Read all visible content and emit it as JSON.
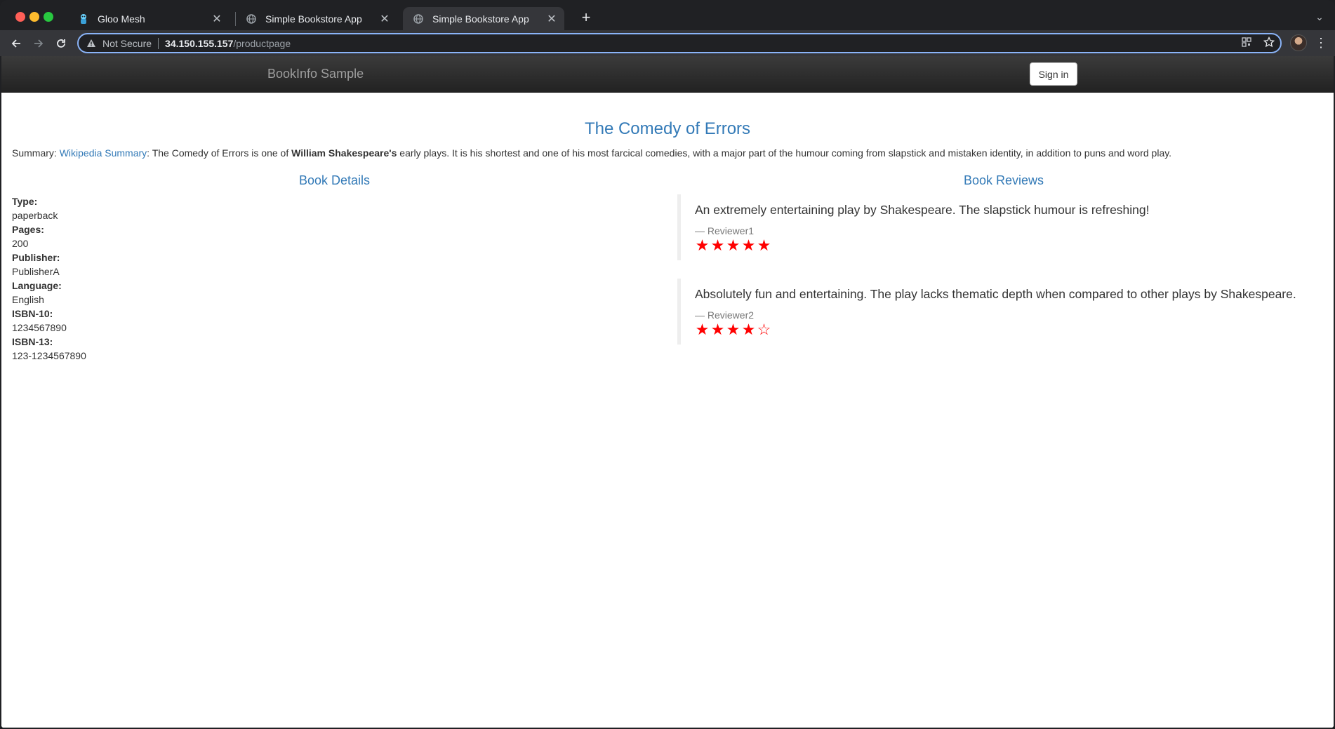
{
  "browser": {
    "tabs": [
      {
        "title": "Gloo Mesh",
        "icon": "gloo-mesh-icon",
        "active": false
      },
      {
        "title": "Simple Bookstore App",
        "icon": "globe-icon",
        "active": false
      },
      {
        "title": "Simple Bookstore App",
        "icon": "globe-icon",
        "active": true
      }
    ],
    "address": {
      "security_label": "Not Secure",
      "host": "34.150.155.157",
      "path": "/productpage"
    }
  },
  "app": {
    "brand": "BookInfo Sample",
    "signin_label": "Sign in"
  },
  "book": {
    "title": "The Comedy of Errors",
    "summary_prefix": "Summary: ",
    "summary_link": "Wikipedia Summary",
    "summary_part1": ": The Comedy of Errors is one of ",
    "summary_bold": "William Shakespeare's",
    "summary_part2": " early plays. It is his shortest and one of his most farcical comedies, with a major part of the humour coming from slapstick and mistaken identity, in addition to puns and word play."
  },
  "details": {
    "heading": "Book Details",
    "fields": [
      {
        "label": "Type:",
        "value": "paperback"
      },
      {
        "label": "Pages:",
        "value": "200"
      },
      {
        "label": "Publisher:",
        "value": "PublisherA"
      },
      {
        "label": "Language:",
        "value": "English"
      },
      {
        "label": "ISBN-10:",
        "value": "1234567890"
      },
      {
        "label": "ISBN-13:",
        "value": "123-1234567890"
      }
    ]
  },
  "reviews": {
    "heading": "Book Reviews",
    "star_color": "#ff0000",
    "items": [
      {
        "text": "An extremely entertaining play by Shakespeare. The slapstick humour is refreshing!",
        "author": "— Reviewer1",
        "rating": 5,
        "max": 5
      },
      {
        "text": "Absolutely fun and entertaining. The play lacks thematic depth when compared to other plays by Shakespeare.",
        "author": "— Reviewer2",
        "rating": 4,
        "max": 5
      }
    ]
  }
}
